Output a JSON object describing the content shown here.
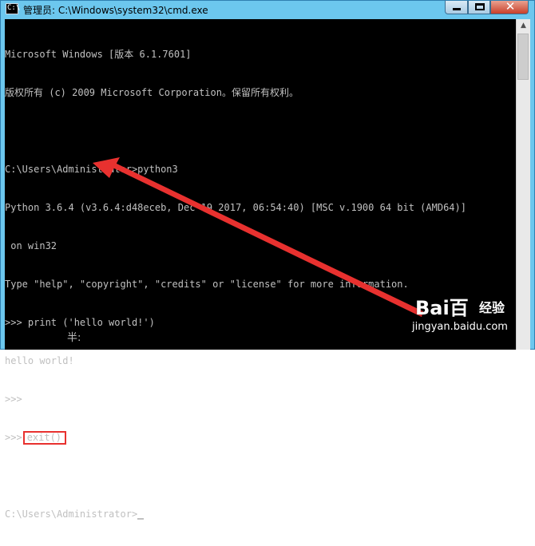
{
  "window": {
    "title": "管理员: C:\\Windows\\system32\\cmd.exe",
    "app_icon_glyph": "C:\\",
    "controls": {
      "minimize": "minimize-icon",
      "maximize": "maximize-icon",
      "close": "close-icon"
    },
    "close_glyph": "✕",
    "frame_color": "#6cc7ee",
    "close_color": "#c8402a"
  },
  "console": {
    "background": "#000000",
    "foreground": "#c0c0c0",
    "lines": [
      "Microsoft Windows [版本 6.1.7601]",
      "版权所有 (c) 2009 Microsoft Corporation。保留所有权利。",
      "",
      "C:\\Users\\Administrator>python3",
      "Python 3.6.4 (v3.6.4:d48eceb, Dec 19 2017, 06:54:40) [MSC v.1900 64 bit (AMD64)]",
      " on win32",
      "Type \"help\", \"copyright\", \"credits\" or \"license\" for more information.",
      ">>> print ('hello world!')",
      "hello world!",
      ">>>",
      ">>>",
      "",
      "C:\\Users\\Administrator>"
    ],
    "highlighted_command": "exit()",
    "ime_indicator": "半:"
  },
  "annotation": {
    "highlight_color": "#e8312f",
    "arrow_color": "#e8312f"
  },
  "watermark": {
    "logo": "Bai百",
    "sub": "经验",
    "url": "jingyan.baidu.com"
  }
}
